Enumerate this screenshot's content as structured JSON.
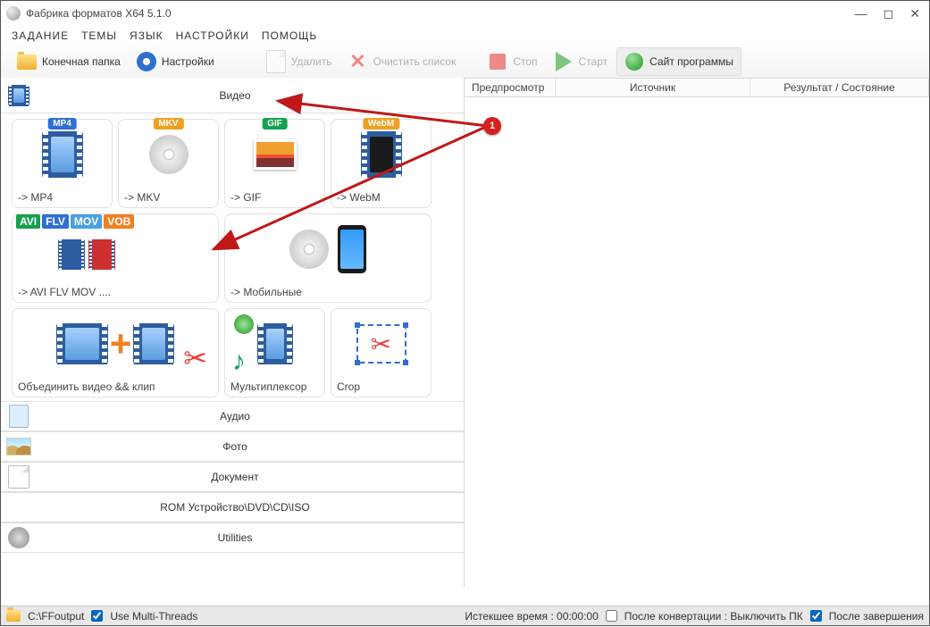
{
  "title": "Фабрика форматов X64 5.1.0",
  "menu": {
    "task": "ЗАДАНИЕ",
    "themes": "ТЕМЫ",
    "lang": "ЯЗЫК",
    "settings": "НАСТРОЙКИ",
    "help": "ПОМОЩЬ"
  },
  "toolbar": {
    "output_folder": "Конечная папка",
    "settings": "Настройки",
    "delete": "Удалить",
    "clear_list": "Очистить список",
    "stop": "Стоп",
    "start": "Старт",
    "website": "Сайт программы"
  },
  "categories": {
    "video": "Видео",
    "audio": "Аудио",
    "photo": "Фото",
    "document": "Документ",
    "rom": "ROM Устройство\\DVD\\CD\\ISO",
    "utilities": "Utilities"
  },
  "video_cards": {
    "mp4": "-> MP4",
    "mkv": "-> MKV",
    "gif": "-> GIF",
    "webm": "-> WebM",
    "multi": "-> AVI FLV MOV ....",
    "mobile": "-> Мобильные",
    "join": "Объединить видео && клип",
    "mux": "Мультиплексор",
    "crop": "Crop"
  },
  "badges": {
    "mp4": "MP4",
    "mkv": "MKV",
    "gif": "GIF",
    "webm": "WebM",
    "avi": "AVI",
    "flv": "FLV",
    "mov": "MOV",
    "vob": "VOB"
  },
  "list_headers": {
    "preview": "Предпросмотр",
    "source": "Источник",
    "result": "Результат / Состояние"
  },
  "status": {
    "output_path": "C:\\FFoutput",
    "multithread": "Use Multi-Threads",
    "elapsed": "Истекшее время : 00:00:00",
    "post_convert": "После конвертации : Выключить ПК",
    "post_finish": "После завершения"
  },
  "annotation": {
    "marker": "1"
  }
}
